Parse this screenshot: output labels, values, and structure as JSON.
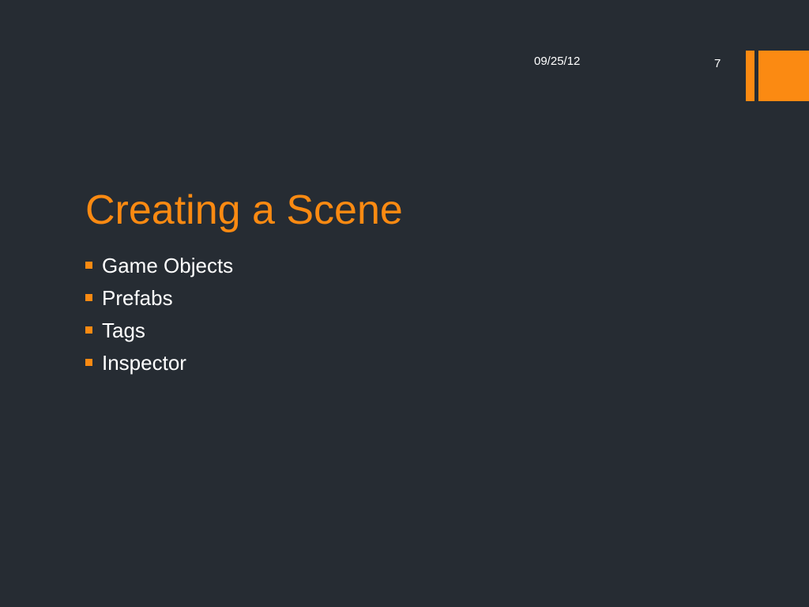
{
  "header": {
    "date": "09/25/12",
    "slide_number": "7"
  },
  "slide": {
    "title": "Creating a Scene",
    "bullets": [
      {
        "label": "Game Objects"
      },
      {
        "label": "Prefabs"
      },
      {
        "label": "Tags"
      },
      {
        "label": "Inspector"
      }
    ]
  },
  "colors": {
    "background": "#262c33",
    "accent": "#fb8a12",
    "text": "#ffffff"
  }
}
